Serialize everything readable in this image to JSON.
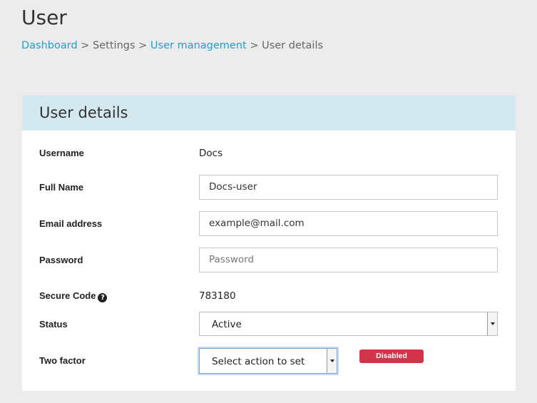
{
  "page": {
    "title": "User"
  },
  "breadcrumb": {
    "items": [
      {
        "label": "Dashboard",
        "link": true
      },
      {
        "label": "Settings",
        "link": false
      },
      {
        "label": "User management",
        "link": true
      },
      {
        "label": "User details",
        "link": false
      }
    ],
    "separator": ">"
  },
  "card": {
    "title": "User details",
    "username": {
      "label": "Username",
      "value": "Docs"
    },
    "full_name": {
      "label": "Full Name",
      "value": "Docs-user"
    },
    "email": {
      "label": "Email address",
      "value": "example@mail.com"
    },
    "password": {
      "label": "Password",
      "placeholder": "Password"
    },
    "secure_code": {
      "label": "Secure Code",
      "help_icon": "question-circle-icon",
      "help_glyph": "?",
      "value": "783180"
    },
    "status": {
      "label": "Status",
      "selected": "Active"
    },
    "two_factor": {
      "label": "Two factor",
      "selected": "Select action to set",
      "badge": "Disabled",
      "badge_color": "#d2344a"
    }
  },
  "colors": {
    "link": "#1a9fd6",
    "header_bg": "#d3e8ef",
    "page_bg": "#ececec"
  }
}
